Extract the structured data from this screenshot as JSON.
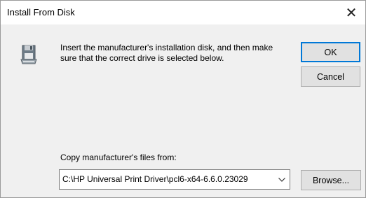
{
  "window": {
    "title": "Install From Disk",
    "close_glyph": "✕"
  },
  "message": {
    "text": "Insert the manufacturer's installation disk, and then make sure that the correct drive is selected below.",
    "icon": "floppy-disk-icon"
  },
  "buttons": {
    "ok": "OK",
    "cancel": "Cancel",
    "browse": "Browse..."
  },
  "copy_from": {
    "label": "Copy manufacturer's files from:",
    "value": "C:\\HP Universal Print Driver\\pcl6-x64-6.6.0.23029"
  },
  "colors": {
    "dialog_bg": "#f0f0f0",
    "title_bg": "#ffffff",
    "default_button_border": "#0078d7"
  }
}
